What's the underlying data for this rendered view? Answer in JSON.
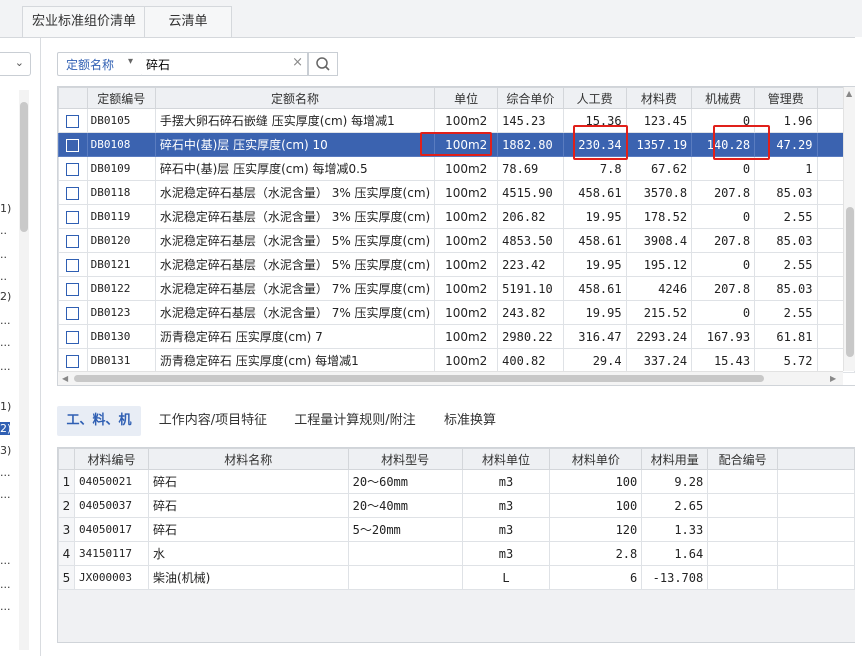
{
  "top_tabs": [
    "宏业标准组价清单",
    "云清单"
  ],
  "left_panel": {
    "labels": [
      "1)",
      "..",
      "..",
      "..",
      "2)",
      "...",
      "...",
      "...",
      "1)",
      "2)",
      "3)",
      "...",
      "...",
      "...",
      "...",
      "..."
    ]
  },
  "search": {
    "type_label": "定额名称",
    "value": "碎石"
  },
  "grid": {
    "headers": [
      "定额编号",
      "定额名称",
      "单位",
      "综合单价",
      "人工费",
      "材料费",
      "机械费",
      "管理费"
    ],
    "rows": [
      {
        "code": "DB0105",
        "name": "手摆大卵石碎石嵌缝 压实厚度(cm) 每增减1",
        "unit": "100m2",
        "price": "145.23",
        "labor": "15.36",
        "material": "123.45",
        "machine": "0",
        "mgmt": "1.96"
      },
      {
        "code": "DB0108",
        "name": "碎石中(基)层 压实厚度(cm) 10",
        "unit": "100m2",
        "price": "1882.80",
        "labor": "230.34",
        "material": "1357.19",
        "machine": "140.28",
        "mgmt": "47.29"
      },
      {
        "code": "DB0109",
        "name": "碎石中(基)层 压实厚度(cm) 每增减0.5",
        "unit": "100m2",
        "price": "78.69",
        "labor": "7.8",
        "material": "67.62",
        "machine": "0",
        "mgmt": "1"
      },
      {
        "code": "DB0118",
        "name": "水泥稳定碎石基层（水泥含量） 3% 压实厚度(cm)",
        "unit": "100m2",
        "price": "4515.90",
        "labor": "458.61",
        "material": "3570.8",
        "machine": "207.8",
        "mgmt": "85.03"
      },
      {
        "code": "DB0119",
        "name": "水泥稳定碎石基层（水泥含量） 3% 压实厚度(cm)",
        "unit": "100m2",
        "price": "206.82",
        "labor": "19.95",
        "material": "178.52",
        "machine": "0",
        "mgmt": "2.55"
      },
      {
        "code": "DB0120",
        "name": "水泥稳定碎石基层（水泥含量） 5% 压实厚度(cm)",
        "unit": "100m2",
        "price": "4853.50",
        "labor": "458.61",
        "material": "3908.4",
        "machine": "207.8",
        "mgmt": "85.03"
      },
      {
        "code": "DB0121",
        "name": "水泥稳定碎石基层（水泥含量） 5% 压实厚度(cm)",
        "unit": "100m2",
        "price": "223.42",
        "labor": "19.95",
        "material": "195.12",
        "machine": "0",
        "mgmt": "2.55"
      },
      {
        "code": "DB0122",
        "name": "水泥稳定碎石基层（水泥含量） 7% 压实厚度(cm)",
        "unit": "100m2",
        "price": "5191.10",
        "labor": "458.61",
        "material": "4246",
        "machine": "207.8",
        "mgmt": "85.03"
      },
      {
        "code": "DB0123",
        "name": "水泥稳定碎石基层（水泥含量） 7% 压实厚度(cm)",
        "unit": "100m2",
        "price": "243.82",
        "labor": "19.95",
        "material": "215.52",
        "machine": "0",
        "mgmt": "2.55"
      },
      {
        "code": "DB0130",
        "name": "沥青稳定碎石 压实厚度(cm) 7",
        "unit": "100m2",
        "price": "2980.22",
        "labor": "316.47",
        "material": "2293.24",
        "machine": "167.93",
        "mgmt": "61.81"
      },
      {
        "code": "DB0131",
        "name": "沥青稳定碎石 压实厚度(cm) 每增减1",
        "unit": "100m2",
        "price": "400.82",
        "labor": "29.4",
        "material": "337.24",
        "machine": "15.43",
        "mgmt": "5.72"
      }
    ]
  },
  "bottom_tabs": [
    "工、料、机",
    "工作内容/项目特征",
    "工程量计算规则/附注",
    "标准换算"
  ],
  "materials": {
    "headers": [
      "材料编号",
      "材料名称",
      "材料型号",
      "材料单位",
      "材料单价",
      "材料用量",
      "配合编号"
    ],
    "rows": [
      {
        "no": "1",
        "code": "04050021",
        "name": "碎石",
        "model": "20～60mm",
        "unit": "m3",
        "price": "100",
        "qty": "9.28",
        "mix": ""
      },
      {
        "no": "2",
        "code": "04050037",
        "name": "碎石",
        "model": "20～40mm",
        "unit": "m3",
        "price": "100",
        "qty": "2.65",
        "mix": ""
      },
      {
        "no": "3",
        "code": "04050017",
        "name": "碎石",
        "model": "5～20mm",
        "unit": "m3",
        "price": "120",
        "qty": "1.33",
        "mix": ""
      },
      {
        "no": "4",
        "code": "34150117",
        "name": "水",
        "model": "",
        "unit": "m3",
        "price": "2.8",
        "qty": "1.64",
        "mix": ""
      },
      {
        "no": "5",
        "code": "JX000003",
        "name": "柴油(机械)",
        "model": "",
        "unit": "L",
        "price": "6",
        "qty": "-13.708",
        "mix": ""
      }
    ]
  },
  "colors": {
    "accent": "#2f5fb3",
    "selected_row": "#3b63b0",
    "highlight_box": "#e0201a"
  }
}
